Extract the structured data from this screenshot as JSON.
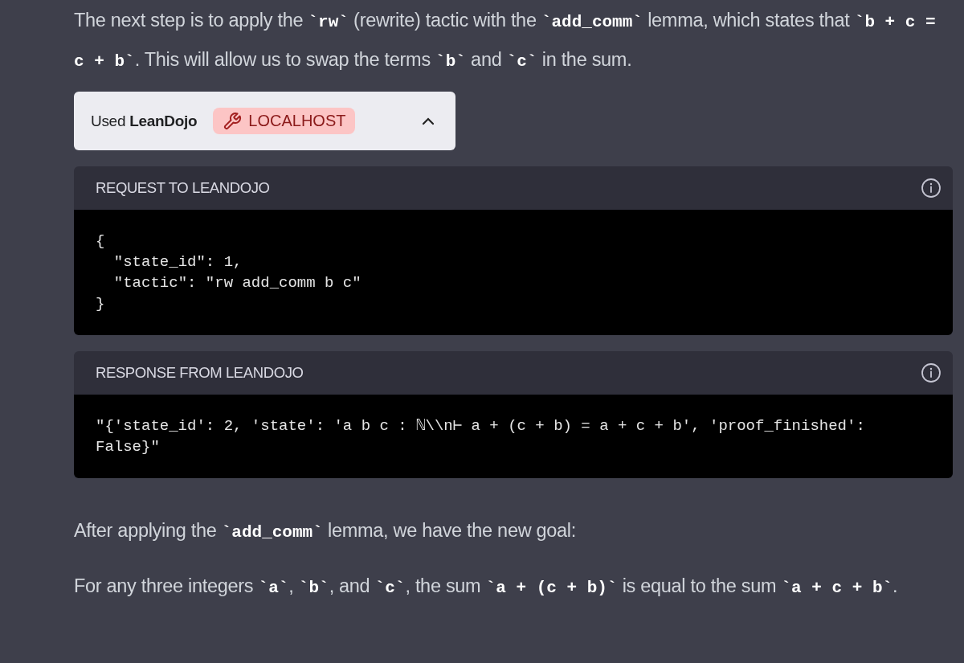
{
  "intro": [
    {
      "kind": "text",
      "text": "The next step is to apply the "
    },
    {
      "kind": "code",
      "text": "`rw`"
    },
    {
      "kind": "text",
      "text": " (rewrite) tactic with the "
    },
    {
      "kind": "code",
      "text": "`add_comm`"
    },
    {
      "kind": "text",
      "text": " lemma, which states that "
    },
    {
      "kind": "code",
      "text": "`b + c = c + b`"
    },
    {
      "kind": "text",
      "text": ". This will allow us to swap the terms "
    },
    {
      "kind": "code",
      "text": "`b`"
    },
    {
      "kind": "text",
      "text": " and "
    },
    {
      "kind": "code",
      "text": "`c`"
    },
    {
      "kind": "text",
      "text": " in the sum."
    }
  ],
  "plugin": {
    "prefix": "Used",
    "name": "LeanDojo",
    "badge": "LOCALHOST",
    "expanded": true
  },
  "blocks": [
    {
      "title": "REQUEST TO LEANDOJO",
      "code": "{\n  \"state_id\": 1,\n  \"tactic\": \"rw add_comm b c\"\n}"
    },
    {
      "title": "RESPONSE FROM LEANDOJO",
      "code": "\"{'state_id': 2, 'state': 'a b c : ℕ\\\\n⊢ a + (c + b) = a + c + b', 'proof_finished': False}\""
    }
  ],
  "paragraphs": [
    [
      {
        "kind": "text",
        "text": "After applying the "
      },
      {
        "kind": "code",
        "text": "`add_comm`"
      },
      {
        "kind": "text",
        "text": " lemma, we have the new goal:"
      }
    ],
    [
      {
        "kind": "text",
        "text": "For any three integers "
      },
      {
        "kind": "code",
        "text": "`a`"
      },
      {
        "kind": "text",
        "text": ", "
      },
      {
        "kind": "code",
        "text": "`b`"
      },
      {
        "kind": "text",
        "text": ", and "
      },
      {
        "kind": "code",
        "text": "`c`"
      },
      {
        "kind": "text",
        "text": ", the sum "
      },
      {
        "kind": "code",
        "text": "`a + (c + b)`"
      },
      {
        "kind": "text",
        "text": " is equal to the sum "
      },
      {
        "kind": "code",
        "text": "`a + c + b`"
      },
      {
        "kind": "text",
        "text": "."
      }
    ]
  ]
}
